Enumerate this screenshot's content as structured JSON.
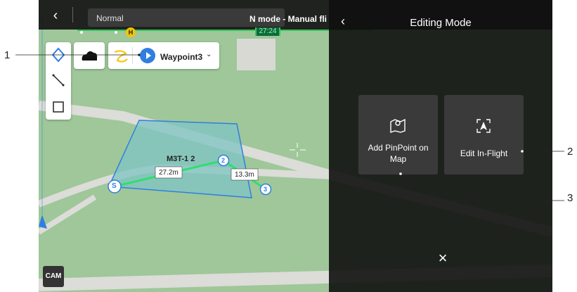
{
  "topbar": {
    "flight_mode": "Normal",
    "status": "N mode - Manual fli",
    "timer": "27:24",
    "home_badge": "H"
  },
  "toolbar": {
    "waypoint_label": "Waypoint3"
  },
  "map": {
    "area_label": "M3T-1 2",
    "distance_1": "27.2m",
    "distance_2": "13.3m",
    "start_marker": "S",
    "marker_2": "2",
    "marker_3": "3"
  },
  "bottom": {
    "cam_label": "CAM"
  },
  "overlay": {
    "title": "Editing Mode",
    "option_1": {
      "line1": "Add PinPoint on",
      "line2": "Map"
    },
    "option_2": {
      "label": "Edit In-Flight"
    },
    "close": "×"
  },
  "callouts": {
    "c1": "1",
    "c2": "2",
    "c3": "3"
  },
  "colors": {
    "accent_blue": "#2f7fe0",
    "green_line": "#2ee06e",
    "polygon_fill": "#7fc4c4"
  }
}
